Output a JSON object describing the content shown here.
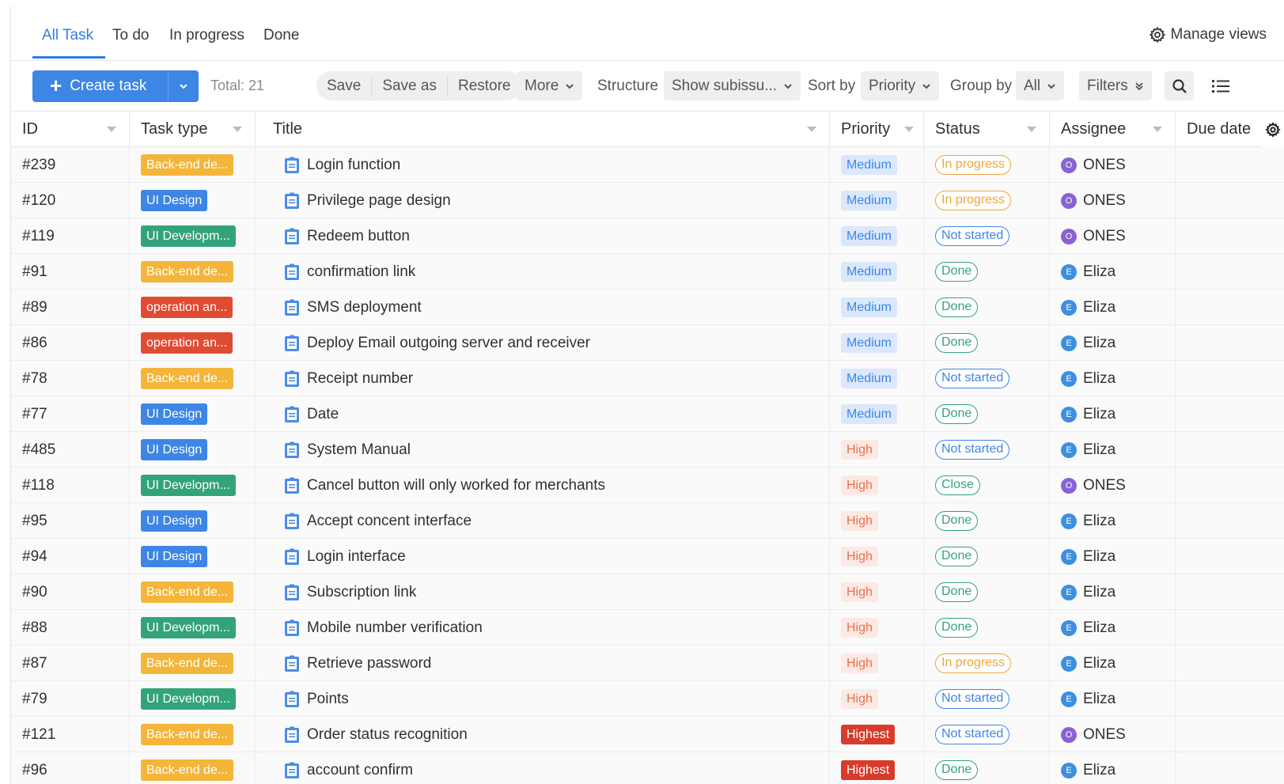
{
  "tabs": [
    {
      "label": "All Task",
      "active": true
    },
    {
      "label": "To do",
      "active": false
    },
    {
      "label": "In progress",
      "active": false
    },
    {
      "label": "Done",
      "active": false
    }
  ],
  "manage_views": {
    "label": "Manage views",
    "icon": "gear-icon"
  },
  "toolbar": {
    "create_label": "Create task",
    "total": "Total: 21",
    "save": "Save",
    "save_as": "Save as",
    "restore": "Restore",
    "more": "More",
    "structure_label": "Structure",
    "structure_value": "Show subissu...",
    "sort_label": "Sort by",
    "sort_value": "Priority",
    "group_label": "Group by",
    "group_value": "All",
    "filters": "Filters"
  },
  "columns": {
    "id": "ID",
    "type": "Task type",
    "title": "Title",
    "priority": "Priority",
    "status": "Status",
    "assignee": "Assignee",
    "due": "Due date"
  },
  "colors": {
    "accent": "#3d86e6",
    "type_backend": "#f3b53a",
    "type_ui_design": "#3d86e6",
    "type_ui_dev": "#33a37a",
    "type_operation": "#e04b33",
    "priority_medium_bg": "#dbe8fb",
    "priority_medium_fg": "#3d86e6",
    "priority_high_bg": "#fde9e4",
    "priority_high_fg": "#e6724d",
    "priority_highest_bg": "#d83b2b",
    "status_in_progress": "#f0a53a",
    "status_not_started": "#3d86e6",
    "status_done": "#33a37a",
    "status_close": "#33a37a",
    "avatar_ones": "#8a63d2",
    "avatar_eliza": "#3d8fe0"
  },
  "rows": [
    {
      "id": "#239",
      "type": "Back-end de...",
      "type_kind": "backend",
      "title": "Login function",
      "priority": "Medium",
      "status": "In progress",
      "assignee": "ONES",
      "avatar": "O"
    },
    {
      "id": "#120",
      "type": "UI Design",
      "type_kind": "ui_design",
      "title": "Privilege page design",
      "priority": "Medium",
      "status": "In progress",
      "assignee": "ONES",
      "avatar": "O"
    },
    {
      "id": "#119",
      "type": "UI Developm...",
      "type_kind": "ui_dev",
      "title": "Redeem button",
      "priority": "Medium",
      "status": "Not started",
      "assignee": "ONES",
      "avatar": "O"
    },
    {
      "id": "#91",
      "type": "Back-end de...",
      "type_kind": "backend",
      "title": "confirmation link",
      "priority": "Medium",
      "status": "Done",
      "assignee": "Eliza",
      "avatar": "E"
    },
    {
      "id": "#89",
      "type": "operation an...",
      "type_kind": "operation",
      "title": "SMS deployment",
      "priority": "Medium",
      "status": "Done",
      "assignee": "Eliza",
      "avatar": "E"
    },
    {
      "id": "#86",
      "type": "operation an...",
      "type_kind": "operation",
      "title": "Deploy Email outgoing server and receiver",
      "priority": "Medium",
      "status": "Done",
      "assignee": "Eliza",
      "avatar": "E"
    },
    {
      "id": "#78",
      "type": "Back-end de...",
      "type_kind": "backend",
      "title": "Receipt number",
      "priority": "Medium",
      "status": "Not started",
      "assignee": "Eliza",
      "avatar": "E"
    },
    {
      "id": "#77",
      "type": "UI Design",
      "type_kind": "ui_design",
      "title": "Date",
      "priority": "Medium",
      "status": "Done",
      "assignee": "Eliza",
      "avatar": "E"
    },
    {
      "id": "#485",
      "type": "UI Design",
      "type_kind": "ui_design",
      "title": "System Manual",
      "priority": "High",
      "status": "Not started",
      "assignee": "Eliza",
      "avatar": "E"
    },
    {
      "id": "#118",
      "type": "UI Developm...",
      "type_kind": "ui_dev",
      "title": "Cancel button will only worked for merchants",
      "priority": "High",
      "status": "Close",
      "assignee": "ONES",
      "avatar": "O"
    },
    {
      "id": "#95",
      "type": "UI Design",
      "type_kind": "ui_design",
      "title": "Accept concent interface",
      "priority": "High",
      "status": "Done",
      "assignee": "Eliza",
      "avatar": "E"
    },
    {
      "id": "#94",
      "type": "UI Design",
      "type_kind": "ui_design",
      "title": "Login interface",
      "priority": "High",
      "status": "Done",
      "assignee": "Eliza",
      "avatar": "E"
    },
    {
      "id": "#90",
      "type": "Back-end de...",
      "type_kind": "backend",
      "title": "Subscription link",
      "priority": "High",
      "status": "Done",
      "assignee": "Eliza",
      "avatar": "E"
    },
    {
      "id": "#88",
      "type": "UI Developm...",
      "type_kind": "ui_dev",
      "title": "Mobile number verification",
      "priority": "High",
      "status": "Done",
      "assignee": "Eliza",
      "avatar": "E"
    },
    {
      "id": "#87",
      "type": "Back-end de...",
      "type_kind": "backend",
      "title": "Retrieve password",
      "priority": "High",
      "status": "In progress",
      "assignee": "Eliza",
      "avatar": "E"
    },
    {
      "id": "#79",
      "type": "UI Developm...",
      "type_kind": "ui_dev",
      "title": "Points",
      "priority": "High",
      "status": "Not started",
      "assignee": "Eliza",
      "avatar": "E"
    },
    {
      "id": "#121",
      "type": "Back-end de...",
      "type_kind": "backend",
      "title": "Order status recognition",
      "priority": "Highest",
      "status": "Not started",
      "assignee": "ONES",
      "avatar": "O"
    },
    {
      "id": "#96",
      "type": "Back-end de...",
      "type_kind": "backend",
      "title": "account confirm",
      "priority": "Highest",
      "status": "Done",
      "assignee": "Eliza",
      "avatar": "E"
    }
  ]
}
